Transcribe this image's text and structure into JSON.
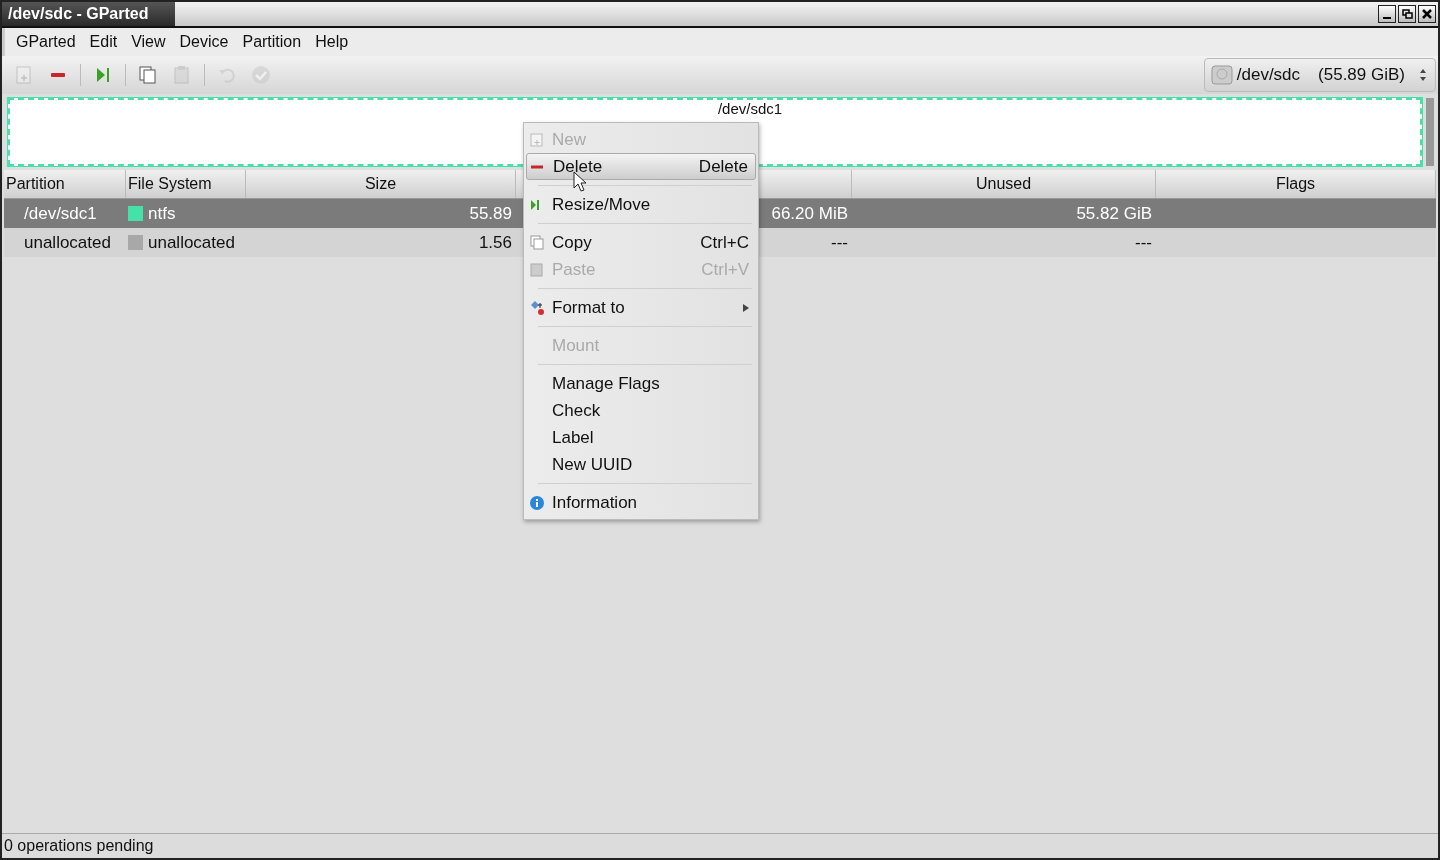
{
  "window": {
    "title": "/dev/sdc - GParted"
  },
  "menubar": [
    "GParted",
    "Edit",
    "View",
    "Device",
    "Partition",
    "Help"
  ],
  "toolbar": [
    {
      "disabled": true
    },
    {
      "disabled": false
    },
    {
      "disabled": false
    },
    {
      "disabled": false
    },
    {
      "disabled": true
    },
    {
      "disabled": true
    },
    {
      "disabled": true
    }
  ],
  "device_selector": {
    "device": "/dev/sdc",
    "size": "(55.89 GiB)"
  },
  "disk_map": {
    "label": "/dev/sdc1"
  },
  "table": {
    "columns": [
      "Partition",
      "File System",
      "Size",
      "",
      "Unused",
      "Flags"
    ],
    "rows": [
      {
        "selected": true,
        "partition": "/dev/sdc1",
        "color": "#44e2a8",
        "file_system": "ntfs",
        "size": "55.89",
        "column_4": "66.20 MiB",
        "unused": "55.82 GiB"
      },
      {
        "selected": false,
        "partition": "unallocated",
        "color": "#a8a8a8",
        "file_system": "unallocated",
        "size": "1.56",
        "column_4": "---",
        "unused": "---"
      }
    ]
  },
  "context_menu": [
    {
      "kind": "item",
      "label": "New",
      "disabled": true,
      "selected": false
    },
    {
      "kind": "item",
      "label": "Delete",
      "shortcut": "Delete",
      "disabled": false,
      "selected": true
    },
    {
      "kind": "separator"
    },
    {
      "kind": "item",
      "label": "Resize/Move",
      "disabled": false,
      "selected": false
    },
    {
      "kind": "separator"
    },
    {
      "kind": "item",
      "label": "Copy",
      "shortcut": "Ctrl+C",
      "disabled": false,
      "selected": false
    },
    {
      "kind": "item",
      "label": "Paste",
      "shortcut": "Ctrl+V",
      "disabled": true,
      "selected": false
    },
    {
      "kind": "separator"
    },
    {
      "kind": "item",
      "label": "Format to",
      "submenu": true,
      "disabled": false,
      "selected": false
    },
    {
      "kind": "separator"
    },
    {
      "kind": "item",
      "label": "Mount",
      "disabled": true,
      "selected": false
    },
    {
      "kind": "separator"
    },
    {
      "kind": "item",
      "label": "Manage Flags",
      "disabled": false,
      "selected": false
    },
    {
      "kind": "item",
      "label": "Check",
      "disabled": false,
      "selected": false
    },
    {
      "kind": "item",
      "label": "Label",
      "disabled": false,
      "selected": false
    },
    {
      "kind": "item",
      "label": "New UUID",
      "disabled": false,
      "selected": false
    },
    {
      "kind": "separator"
    },
    {
      "kind": "item",
      "label": "Information",
      "disabled": false,
      "selected": false
    }
  ],
  "status_bar": "0 operations pending"
}
